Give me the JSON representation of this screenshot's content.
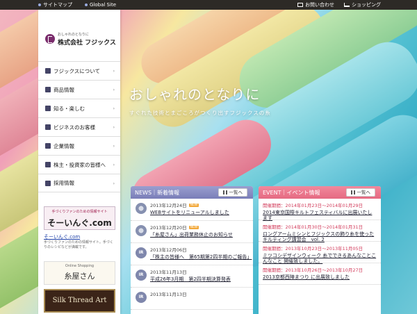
{
  "topbar": {
    "sitemap": "サイトマップ",
    "global": "Global Site",
    "contact": "お問い合わせ",
    "shopping": "ショッピング"
  },
  "logo": {
    "tagline": "おしゃれのとなりに",
    "company": "株式会社 フジックス"
  },
  "nav": [
    {
      "label": "フジックスについて",
      "icon": "fujix-icon"
    },
    {
      "label": "商品情報",
      "icon": "products-icon"
    },
    {
      "label": "知る・楽しむ",
      "icon": "learn-icon"
    },
    {
      "label": "ビジネスのお客様",
      "icon": "business-icon"
    },
    {
      "label": "企業情報",
      "icon": "company-icon"
    },
    {
      "label": "株主・投資家の皆様へ",
      "icon": "investor-icon"
    },
    {
      "label": "採用情報",
      "icon": "recruit-icon"
    }
  ],
  "banners": {
    "soing_caption": "手づくりファンのための情報サイト",
    "soing_title": "そーいんぐ.com",
    "soing_link": "そーいんぐ.com",
    "soing_desc": "手づくりファンのための情報サイト。手づくりのレシピなどが満載です。",
    "itoya_caption": "Online Shopping",
    "itoya_title": "糸屋さん",
    "silk_title": "Silk Thread Art"
  },
  "hero": {
    "catch": "おしゃれのとなりに",
    "sub": "すぐれた技術とまごころがつくり出すフジックスの糸"
  },
  "news": {
    "heading": "NEWS｜新着情報",
    "list_button": "一覧へ",
    "items": [
      {
        "date": "2013年12月24日",
        "badge": "NEW",
        "title": "WEBサイトをリニューアルしました",
        "icon": "spool"
      },
      {
        "date": "2013年12月20日",
        "badge": "NEW",
        "title": "「糸屋さん」出荷業務休止のお知らせ",
        "icon": "spool"
      },
      {
        "date": "2013年12月06日",
        "badge": "",
        "title": "「株主の皆様へ　第65期第2四半期のご報告」",
        "icon": "IR"
      },
      {
        "date": "2013年11月13日",
        "badge": "",
        "title": "平成26年3月期　第2四半期決算発表",
        "icon": "IR"
      },
      {
        "date": "2013年11月13日",
        "badge": "",
        "title": "",
        "icon": "IR"
      }
    ]
  },
  "event": {
    "heading": "EVENT｜イベント情報",
    "list_button": "一覧へ",
    "items": [
      {
        "date": "開催期間：2014年01月23日〜2014年01月29日",
        "title": "2014東京国際キルトフェスティバルに出展いたします"
      },
      {
        "date": "開催期間：2014年01月30日〜2014年01月31日",
        "title": "ロングアームミシンとフジックスの飾り糸を使ったキルティング講習会　vol. 2"
      },
      {
        "date": "開催期間：2013年10月23日〜2013年11月05日",
        "title": "ミツコシデザインウィーク 糸でできるあんなことこんなこと 開催致しました。"
      },
      {
        "date": "開催期間：2013年10月26日〜2013年10月27日",
        "title": "2013京都西陣まつり に出展致しました"
      }
    ]
  }
}
